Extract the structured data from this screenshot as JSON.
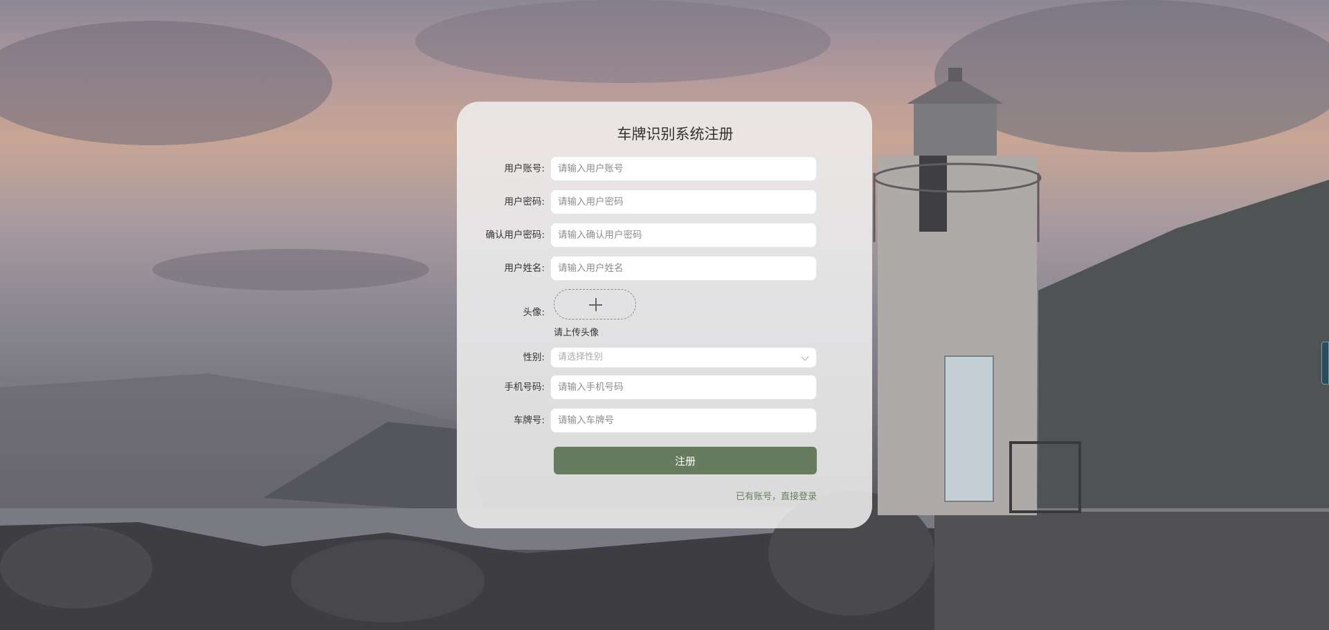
{
  "form": {
    "title": "车牌识别系统注册",
    "fields": [
      {
        "label": "用户账号:",
        "placeholder": "请输入用户账号"
      },
      {
        "label": "用户密码:",
        "placeholder": "请输入用户密码"
      },
      {
        "label": "确认用户密码:",
        "placeholder": "请输入确认用户密码"
      },
      {
        "label": "用户姓名:",
        "placeholder": "请输入用户姓名"
      }
    ],
    "avatar": {
      "label": "头像:",
      "hint": "请上传头像"
    },
    "gender": {
      "label": "性别:",
      "placeholder": "请选择性别"
    },
    "fields2": [
      {
        "label": "手机号码:",
        "placeholder": "请输入手机号码"
      },
      {
        "label": "车牌号:",
        "placeholder": "请输入车牌号"
      }
    ],
    "submit_label": "注册",
    "login_link": "已有账号，直接登录"
  },
  "theme": {
    "button": "#677c5f",
    "link": "#6b7f5f"
  }
}
